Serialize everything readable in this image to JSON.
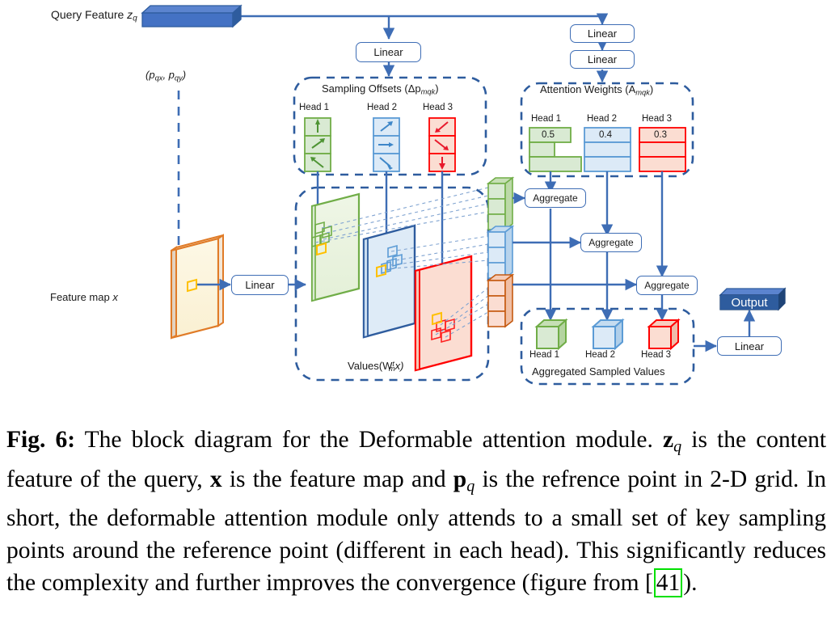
{
  "figure": {
    "title_label": "Fig. 6:",
    "caption_parts": {
      "p1": "The block diagram for the Deformable attention module.",
      "z": "z",
      "zsub": "q",
      "p2": "is the content feature of the query,",
      "x": "x",
      "p3": "is the feature map and",
      "p": "p",
      "psub": "q",
      "p4": "is the refrence point in 2-D grid. In short, the deformable attention module only attends to a small set of key sampling points around the reference point (different in each head). This significantly reduces the complexity and further improves the convergence (figure from",
      "ref": "41",
      "p5": ").",
      "openbracket": "["
    }
  },
  "diagram": {
    "query_feature": {
      "label_text": "Query Feature ",
      "label_var": "z",
      "label_sub": "q"
    },
    "reference_point": {
      "label": "(p",
      "sub1": "qx",
      "mid": ", p",
      "sub2": "qy",
      "close": ")"
    },
    "feature_map": {
      "label_text": "Feature map ",
      "label_var": "x"
    },
    "linear_boxes": [
      {
        "name": "linear-offsets",
        "label": "Linear"
      },
      {
        "name": "linear-attn-1",
        "label": "Linear"
      },
      {
        "name": "linear-attn-2",
        "label": "Linear"
      },
      {
        "name": "linear-values",
        "label": "Linear"
      },
      {
        "name": "linear-output",
        "label": "Linear"
      }
    ],
    "sampling_offsets": {
      "title_text": "Sampling Offsets (Δp",
      "title_sub": "mqk",
      "title_close": ")",
      "heads": [
        {
          "label": "Head 1",
          "color": "#70AD47",
          "fill": "#D9EAD3",
          "arrows": [
            "up",
            "up-right",
            "down-left"
          ]
        },
        {
          "label": "Head 2",
          "color": "#5B9BD5",
          "fill": "#DCEAF7",
          "arrows": [
            "up-right",
            "right",
            "down-right"
          ]
        },
        {
          "label": "Head 3",
          "color": "#FF0000",
          "fill": "#FBDDD2",
          "arrows": [
            "down-left",
            "down-right",
            "down"
          ]
        }
      ]
    },
    "attention_weights": {
      "title_text": "Attention Weights (A",
      "title_sub": "mqk",
      "title_close": ")",
      "heads": [
        {
          "label": "Head 1",
          "value": "0.5",
          "color": "#70AD47",
          "fill": "#D9EAD3",
          "bar_widths": [
            0.78,
            0.48,
            1.0
          ]
        },
        {
          "label": "Head 2",
          "value": "0.4",
          "color": "#5B9BD5",
          "fill": "#DCEAF7",
          "bar_widths": [
            1.0,
            1.0,
            1.0
          ]
        },
        {
          "label": "Head 3",
          "value": "0.3",
          "color": "#FF0000",
          "fill": "#FBDDD2",
          "bar_widths": [
            1.0,
            1.0,
            1.0
          ]
        }
      ]
    },
    "values_box": {
      "title_text": "Values(W",
      "title_sup": "t",
      "title_sub": "m",
      "title_tail": "x)",
      "planes": [
        {
          "name": "values-plane-head1",
          "color": "#70AD47",
          "fill": "#EAF3E3"
        },
        {
          "name": "values-plane-head2",
          "color": "#2E5C9E",
          "fill": "#DEEBF7"
        },
        {
          "name": "values-plane-head3",
          "color": "#FF0000",
          "fill": "#FBDDD2"
        }
      ]
    },
    "sampled_value_stacks": [
      {
        "name": "sampled-values-head1",
        "color": "#70AD47",
        "fill": "#D9EAD3"
      },
      {
        "name": "sampled-values-head2",
        "color": "#5B9BD5",
        "fill": "#DCEAF7"
      },
      {
        "name": "sampled-values-head3",
        "color": "#C55A11",
        "fill": "#FBDDD2"
      }
    ],
    "aggregate_boxes": [
      {
        "name": "aggregate-head1",
        "label": "Aggregate"
      },
      {
        "name": "aggregate-head2",
        "label": "Aggregate"
      },
      {
        "name": "aggregate-head3",
        "label": "Aggregate"
      }
    ],
    "aggregated_sampled_values": {
      "title": "Aggregated Sampled Values",
      "heads": [
        {
          "label": "Head 1",
          "color": "#70AD47",
          "fill": "#D9EAD3"
        },
        {
          "label": "Head 2",
          "color": "#5B9BD5",
          "fill": "#DCEAF7"
        },
        {
          "label": "Head 3",
          "color": "#FF0000",
          "fill": "#FBDDD2"
        }
      ]
    },
    "output": {
      "label": "Output"
    },
    "colors": {
      "arrow_blue": "#3E6DB5",
      "dashed_border": "#2E5C9E",
      "orange": "#E07B27",
      "yellow": "#FFC000",
      "query_fill": "#4472C4",
      "query_top": "#5B84CF",
      "query_side": "#2E5C9E"
    }
  }
}
